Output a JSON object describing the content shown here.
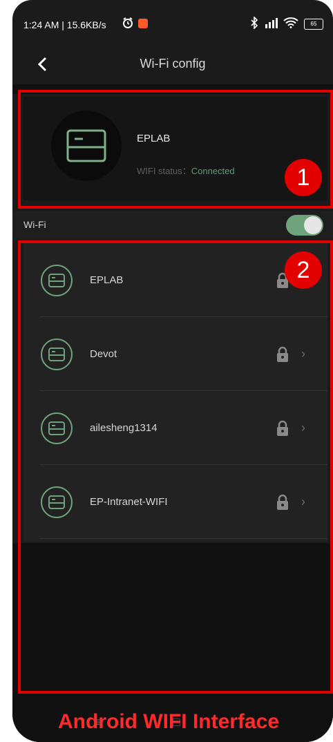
{
  "status_bar": {
    "time_speed": "1:24 AM | 15.6KB/s",
    "icons": [
      "alarm-icon",
      "app-notification-icon",
      "bluetooth-icon",
      "signal-icon",
      "wifi-icon",
      "battery-icon"
    ],
    "battery_level": "65"
  },
  "header": {
    "title": "Wi-Fi config"
  },
  "current_network": {
    "name": "EPLAB",
    "status_label": "WIFI status：",
    "status_value": "Connected"
  },
  "wifi_toggle": {
    "label": "Wi-Fi",
    "state": "on"
  },
  "networks": [
    {
      "name": "EPLAB"
    },
    {
      "name": "Devot"
    },
    {
      "name": "ailesheng1314"
    },
    {
      "name": "EP-Intranet-WIFI"
    }
  ],
  "annotations": {
    "badge_1": "1",
    "badge_2": "2",
    "caption": "Android WIFI Interface",
    "color": "#e30000"
  },
  "colors": {
    "accent_green": "#6fa37b",
    "status_green": "#5b9a76",
    "background": "#1b1b1b"
  }
}
